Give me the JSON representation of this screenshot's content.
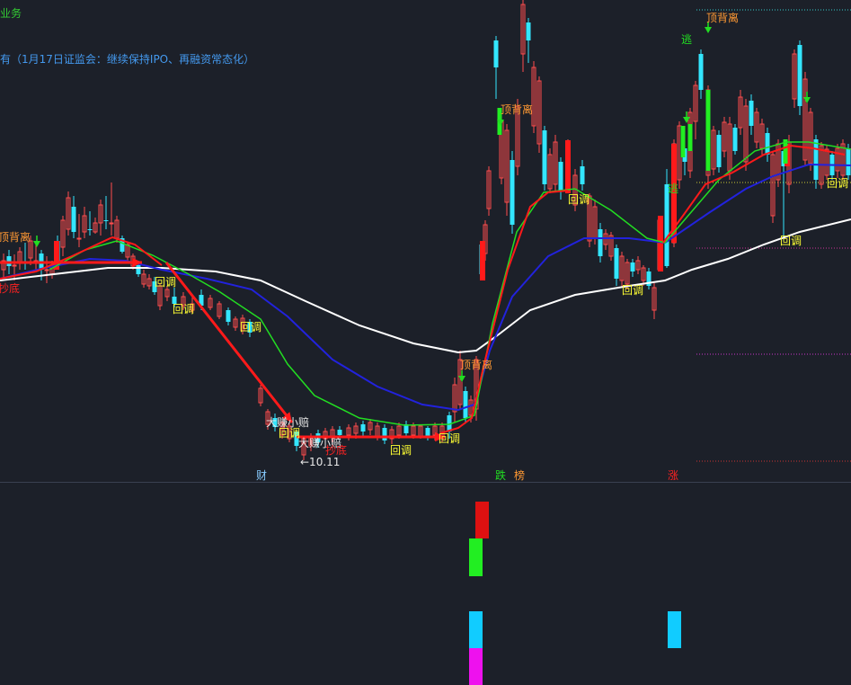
{
  "header": {
    "title_fragment": "业务",
    "news_fragment": "有（1月17日证监会：继续保持IPO、再融资常态化）"
  },
  "annotations": {
    "retracement": "回调",
    "sell": "逃",
    "top_divergence": "顶背离",
    "bottom_fishing": "抄底",
    "gain_small_loss": "大赚小赔",
    "price_low": "←10.11",
    "caption_finance": "财",
    "caption_fall": "跌",
    "caption_list": "榜",
    "caption_rise": "涨"
  },
  "chart_data": {
    "type": "candlestick",
    "price_low_label": "10.11",
    "ma_lines": [
      "white-long",
      "blue-mid",
      "green-short",
      "red-fast"
    ],
    "colors": {
      "background": "#1c2029",
      "up_candle": "#ff4d4d",
      "down_candle": "#33e6ff",
      "ma_white": "#ffffff",
      "ma_blue": "#2222dd",
      "ma_green": "#22dd22",
      "ma_red": "#ff1a1a",
      "text_yellow": "#ffff33",
      "text_orange": "#ff9933",
      "text_red": "#ff2222",
      "text_white": "#e8e8e8",
      "text_green": "#22dd22"
    },
    "indicator_bars": [
      {
        "color": "#dd1111"
      },
      {
        "color": "#22ee22"
      },
      {
        "color": "#11ccff"
      },
      {
        "color": "#ee11ee"
      },
      {
        "color": "#11ccff"
      }
    ]
  }
}
